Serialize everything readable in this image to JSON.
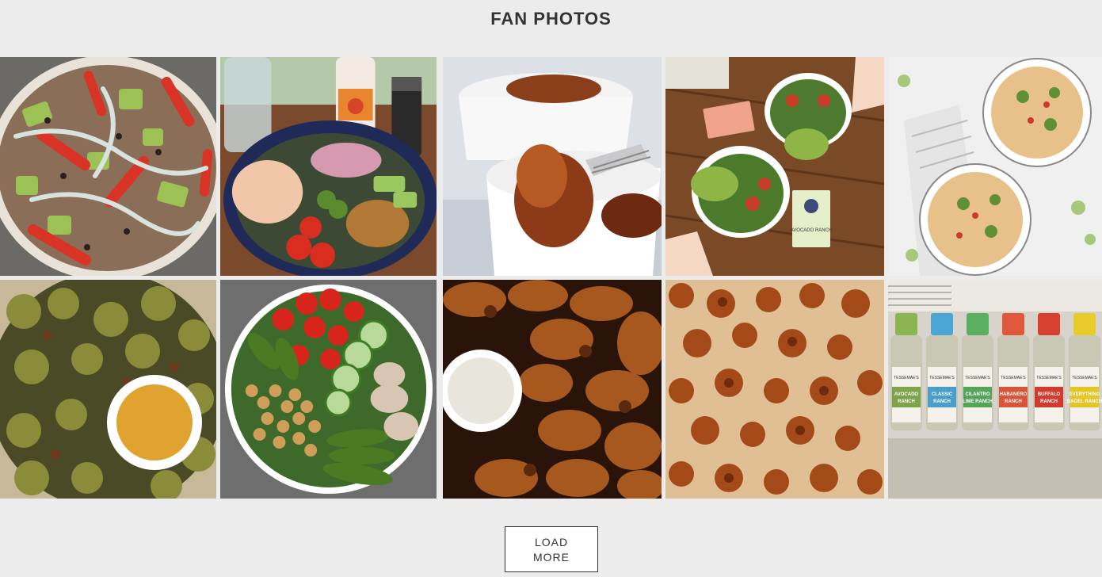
{
  "section": {
    "title": "FAN PHOTOS"
  },
  "photos": [
    {
      "label": "Taco salad with avocado, peppers and ranch drizzle"
    },
    {
      "label": "Shrimp bowl with pickled onions, tomatoes and dressing bottle"
    },
    {
      "label": "Glazed chicken wings in white bowl"
    },
    {
      "label": "Two salads with avocado toast and ranch packets"
    },
    {
      "label": "Two plates of sliced chicken salad on marble"
    },
    {
      "label": "Roasted brussels sprouts with honey mustard dip"
    },
    {
      "label": "Chickpea, avocado, cucumber and tomato bowl"
    },
    {
      "label": "Grilled chicken wings with ranch dip"
    },
    {
      "label": "Roasted buffalo cauliflower on baking sheet"
    },
    {
      "label": "Row of Tessemae's dressing bottles on counter"
    }
  ],
  "bottles": {
    "brand": "TESSEMAE'S",
    "labels": [
      [
        "AVOCADO",
        "RANCH"
      ],
      [
        "CLASSIC",
        "RANCH"
      ],
      [
        "CILANTRO",
        "LIME RANCH"
      ],
      [
        "HABANERO",
        "RANCH"
      ],
      [
        "BUFFALO",
        "RANCH"
      ],
      [
        "EVERYTHING",
        "BAGEL RANCH"
      ]
    ],
    "label_colors": [
      "#7fa34a",
      "#4a9ec9",
      "#56a35a",
      "#d9553a",
      "#d23a2e",
      "#e4c526"
    ],
    "cap_colors": [
      "#8ab551",
      "#4aa6d4",
      "#5ab060",
      "#e0583c",
      "#d8402f",
      "#e8cc2a"
    ]
  },
  "packet": {
    "brand": "TESSEMAE'S",
    "name": "AVOCADO RANCH"
  },
  "load_more": {
    "line1": "LOAD",
    "line2": "MORE"
  }
}
